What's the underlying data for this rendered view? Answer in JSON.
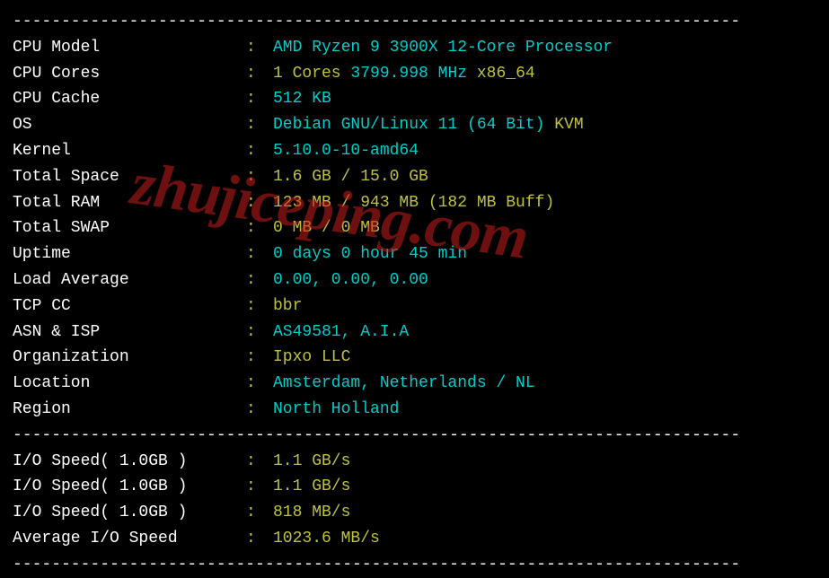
{
  "watermark": "zhujiceping.com",
  "divider_line": "---------------------------------------------------------------------------",
  "system_info": [
    {
      "label": "CPU Model",
      "segments": [
        {
          "text": "AMD Ryzen 9 3900X 12-Core Processor",
          "color": "cyan"
        }
      ]
    },
    {
      "label": "CPU Cores",
      "segments": [
        {
          "text": "1 Cores ",
          "color": "yellow"
        },
        {
          "text": "3799.998 MHz ",
          "color": "cyan"
        },
        {
          "text": "x86_64",
          "color": "yellow"
        }
      ]
    },
    {
      "label": "CPU Cache",
      "segments": [
        {
          "text": "512 KB",
          "color": "cyan"
        }
      ]
    },
    {
      "label": "OS",
      "segments": [
        {
          "text": "Debian GNU/Linux 11 (64 Bit) ",
          "color": "cyan"
        },
        {
          "text": "KVM",
          "color": "yellow"
        }
      ]
    },
    {
      "label": "Kernel",
      "segments": [
        {
          "text": "5.10.0-10-amd64",
          "color": "cyan"
        }
      ]
    },
    {
      "label": "Total Space",
      "segments": [
        {
          "text": "1.6 GB / 15.0 GB",
          "color": "yellow"
        }
      ]
    },
    {
      "label": "Total RAM",
      "segments": [
        {
          "text": "123 MB / 943 MB (182 MB Buff)",
          "color": "yellow"
        }
      ]
    },
    {
      "label": "Total SWAP",
      "segments": [
        {
          "text": "0 MB / 0 MB",
          "color": "yellow"
        }
      ]
    },
    {
      "label": "Uptime",
      "segments": [
        {
          "text": "0 days 0 hour 45 min",
          "color": "cyan"
        }
      ]
    },
    {
      "label": "Load Average",
      "segments": [
        {
          "text": "0.00, 0.00, 0.00",
          "color": "cyan"
        }
      ]
    },
    {
      "label": "TCP CC",
      "segments": [
        {
          "text": "bbr",
          "color": "yellow"
        }
      ]
    },
    {
      "label": "ASN & ISP",
      "segments": [
        {
          "text": "AS49581, A.I.A",
          "color": "cyan"
        }
      ]
    },
    {
      "label": "Organization",
      "segments": [
        {
          "text": "Ipxo LLC",
          "color": "yellow"
        }
      ]
    },
    {
      "label": "Location",
      "segments": [
        {
          "text": "Amsterdam, Netherlands / NL",
          "color": "cyan"
        }
      ]
    },
    {
      "label": "Region",
      "segments": [
        {
          "text": "North Holland",
          "color": "cyan"
        }
      ]
    }
  ],
  "io_speed": [
    {
      "label": "I/O Speed( 1.0GB )",
      "segments": [
        {
          "text": "1.1 GB/s",
          "color": "yellow"
        }
      ]
    },
    {
      "label": "I/O Speed( 1.0GB )",
      "segments": [
        {
          "text": "1.1 GB/s",
          "color": "yellow"
        }
      ]
    },
    {
      "label": "I/O Speed( 1.0GB )",
      "segments": [
        {
          "text": "818 MB/s",
          "color": "yellow"
        }
      ]
    },
    {
      "label": "Average I/O Speed",
      "segments": [
        {
          "text": "1023.6 MB/s",
          "color": "yellow"
        }
      ]
    }
  ],
  "colon_text": ": "
}
